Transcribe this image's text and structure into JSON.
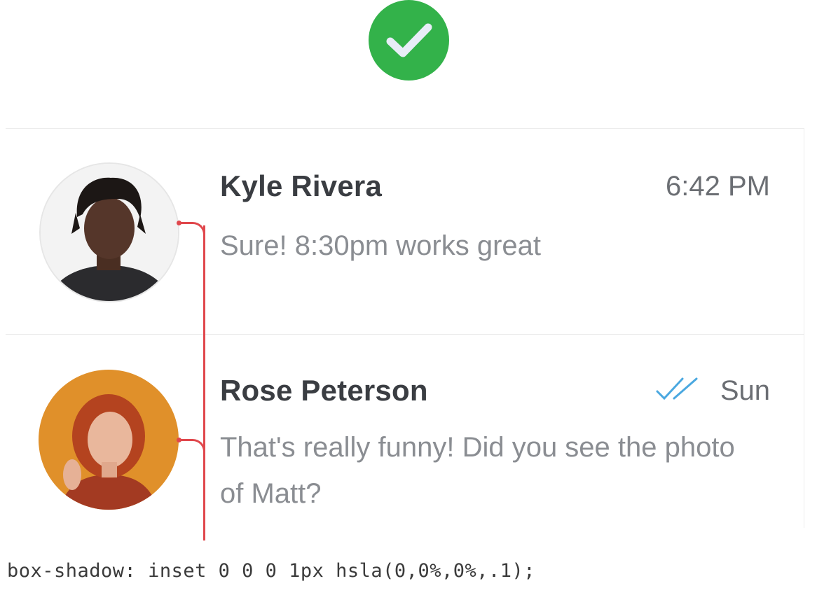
{
  "colors": {
    "check_badge": "#33b24a",
    "annotation": "#e0474c",
    "read_receipt": "#4aa8e0"
  },
  "status_icon": "check-icon",
  "conversations": [
    {
      "name": "Kyle Rivera",
      "time": "6:42 PM",
      "preview": "Sure! 8:30pm works great",
      "avatar": "avatar-kyle",
      "read_receipt": false
    },
    {
      "name": "Rose Peterson",
      "time": "Sun",
      "preview": "That's really funny! Did you see the photo of Matt?",
      "avatar": "avatar-rose",
      "read_receipt": true,
      "read_icon": "double-check-icon"
    }
  ],
  "caption": "box-shadow: inset 0 0 0 1px hsla(0,0%,0%,.1);"
}
